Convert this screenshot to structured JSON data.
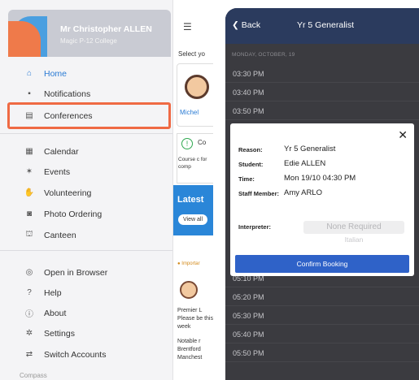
{
  "drawer": {
    "user_name": "Mr Christopher ALLEN",
    "school": "Magic P-12 College",
    "group1": [
      {
        "label": "Home",
        "icon": "home-icon",
        "glyph": "⌂"
      },
      {
        "label": "Notifications",
        "icon": "notifications-icon",
        "glyph": "▪"
      },
      {
        "label": "Conferences",
        "icon": "conferences-icon",
        "glyph": "▤"
      }
    ],
    "group2": [
      {
        "label": "Calendar",
        "icon": "calendar-icon",
        "glyph": "▦"
      },
      {
        "label": "Events",
        "icon": "events-icon",
        "glyph": "✶"
      },
      {
        "label": "Volunteering",
        "icon": "volunteering-icon",
        "glyph": "✋"
      },
      {
        "label": "Photo Ordering",
        "icon": "camera-icon",
        "glyph": "◙"
      },
      {
        "label": "Canteen",
        "icon": "canteen-icon",
        "glyph": "⛫"
      }
    ],
    "group3": [
      {
        "label": "Open in Browser",
        "icon": "globe-icon",
        "glyph": "◎"
      },
      {
        "label": "Help",
        "icon": "help-icon",
        "glyph": "?"
      },
      {
        "label": "About",
        "icon": "info-icon",
        "glyph": "ⓘ"
      },
      {
        "label": "Settings",
        "icon": "gear-icon",
        "glyph": "✲"
      },
      {
        "label": "Switch Accounts",
        "icon": "switch-accounts-icon",
        "glyph": "⇄"
      }
    ],
    "footer": "Compass",
    "accent": "#2a7bd4",
    "highlight_color": "#ef6a44"
  },
  "peek": {
    "select_text": "Select yo",
    "name_text": "Michel",
    "card_title": "Co",
    "course_text": "Course c for comp",
    "latest": "Latest",
    "view_all": "View all",
    "important": "● Importar",
    "para1": "Premier L Please be this week",
    "para2": "Notable r Brentford Manchest"
  },
  "booking": {
    "back_label": "Back",
    "title": "Yr 5 Generalist",
    "date_header": "MONDAY, OCTOBER, 19",
    "slots_top": [
      "03:30 PM",
      "03:40 PM",
      "03:50 PM"
    ],
    "slots_bottom": [
      "05:10 PM",
      "05:20 PM",
      "05:30 PM",
      "05:40 PM",
      "05:50 PM"
    ],
    "dialog": {
      "reason_label": "Reason:",
      "reason_value": "Yr 5 Generalist",
      "student_label": "Student:",
      "student_value": "Edie ALLEN",
      "time_label": "Time:",
      "time_value": "Mon 19/10 04:30 PM",
      "staff_label": "Staff Member:",
      "staff_value": "Amy ARLO",
      "interpreter_label": "Interpreter:",
      "interpreter_value": "None Required",
      "interpreter_option": "Italian",
      "confirm_label": "Confirm Booking"
    },
    "bar_color": "#2b3b5e",
    "button_color": "#2f62c8"
  }
}
